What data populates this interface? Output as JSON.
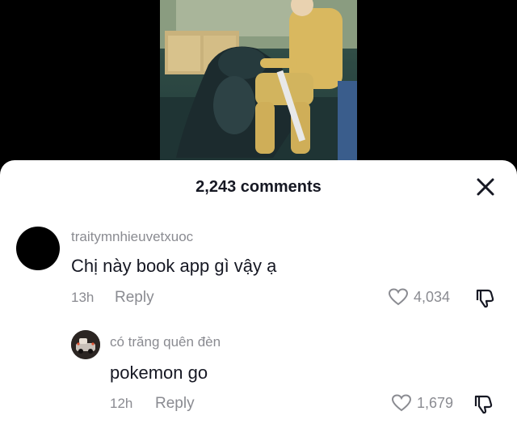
{
  "header": {
    "comment_count": "2,243 comments"
  },
  "comments": [
    {
      "username": "traitymnhieuvetxuoc",
      "text": "Chị này book app gì vậy ạ",
      "time": "13h",
      "reply_label": "Reply",
      "likes": "4,034"
    },
    {
      "username": "có trăng quên đèn",
      "text": "pokemon go",
      "time": "12h",
      "reply_label": "Reply",
      "likes": "1,679"
    }
  ],
  "icons": {
    "close": "close-icon",
    "like": "heart-icon",
    "dislike": "thumbs-down-icon"
  },
  "colors": {
    "primary_text": "#161823",
    "secondary_text": "#8a8b91",
    "sheet_background": "#ffffff"
  }
}
